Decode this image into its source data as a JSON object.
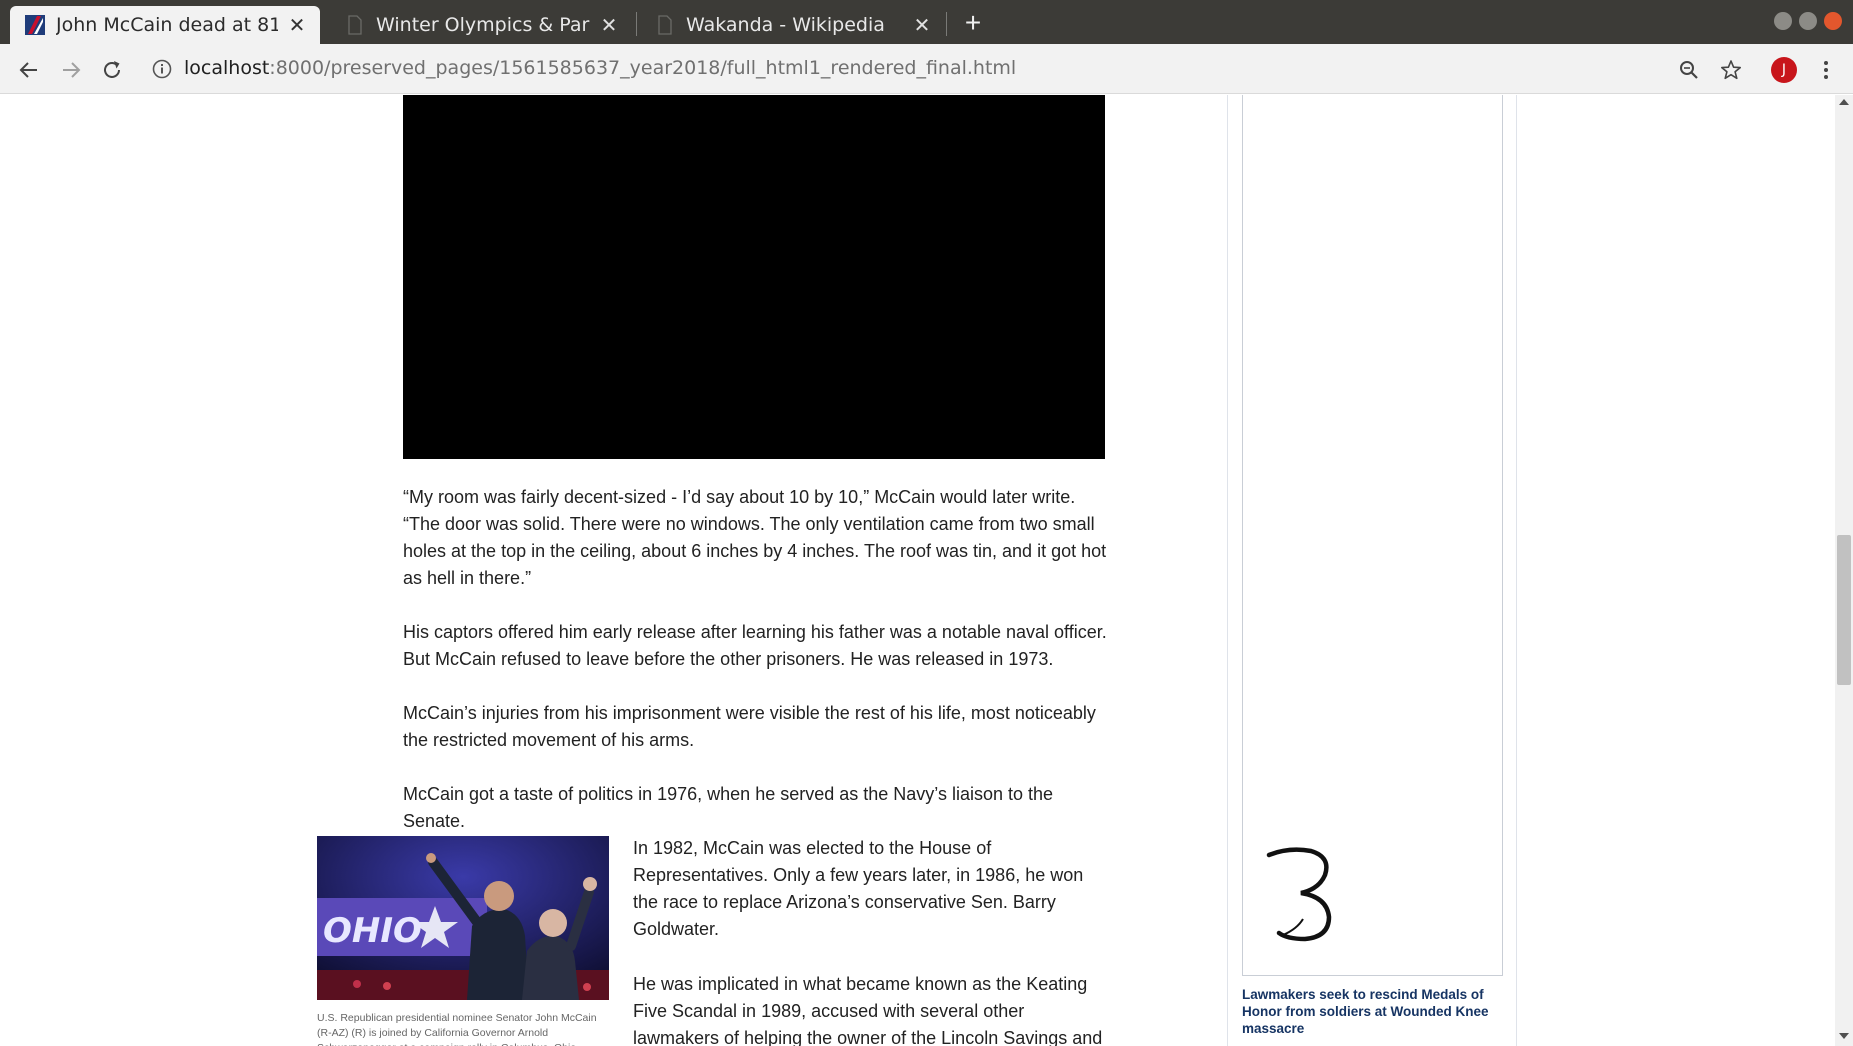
{
  "browser": {
    "tabs": [
      {
        "title": "John McCain dead at 81 |",
        "active": true
      },
      {
        "title": "Winter Olympics & Paraly",
        "active": false
      },
      {
        "title": "Wakanda - Wikipedia",
        "active": false
      }
    ],
    "url_host": "localhost",
    "url_path": ":8000/preserved_pages/1561585637_year2018/full_html1_rendered_final.html",
    "profile_initial": "J",
    "icons": [
      "back-icon",
      "forward-icon",
      "reload-icon",
      "info-icon",
      "zoom-icon",
      "star-icon",
      "menu-icon",
      "new-tab-icon",
      "close-icon"
    ]
  },
  "article": {
    "paragraphs": [
      "“My room was fairly decent-sized - I’d say about 10 by 10,” McCain would later write. “The door was solid. There were no windows. The only ventilation came from two small holes at the top in the ceiling, about 6 inches by 4 inches. The roof was tin, and it got hot as hell in there.”",
      "His captors offered him early release after learning his father was a notable naval officer. But McCain refused to leave before the other prisoners. He was released in 1973.",
      "McCain’s injuries from his imprisonment were visible the rest of his life, most noticeably the restricted movement of his arms.",
      "McCain got a taste of politics in 1976, when he served as the Navy’s liaison to the Senate.",
      "In 1982, McCain was elected to the House of Representatives. Only a few years later, in 1986, he won the race to replace Arizona’s conservative Sen. Barry Goldwater.",
      "He was implicated in what became known as the Keating Five Scandal in 1989, accused with several other lawmakers of helping the owner of the Lincoln Savings and Loan, who"
    ],
    "photo_sign_text": "OHIO",
    "photo_caption": "U.S. Republican presidential nominee Senator John McCain (R-AZ) (R) is joined by California Governor Arnold Schwarzenegger at a campaign rally in Columbus, Ohio"
  },
  "sidebar": {
    "ad_number": "3",
    "link_text": "Lawmakers seek to rescind Medals of Honor from soldiers at Wounded Knee massacre"
  },
  "colors": {
    "tabbar_bg": "#3c3b37",
    "toolbar_bg": "#f2f2f2",
    "sidebar_link": "#163463",
    "profile_avatar": "#c8151b"
  }
}
